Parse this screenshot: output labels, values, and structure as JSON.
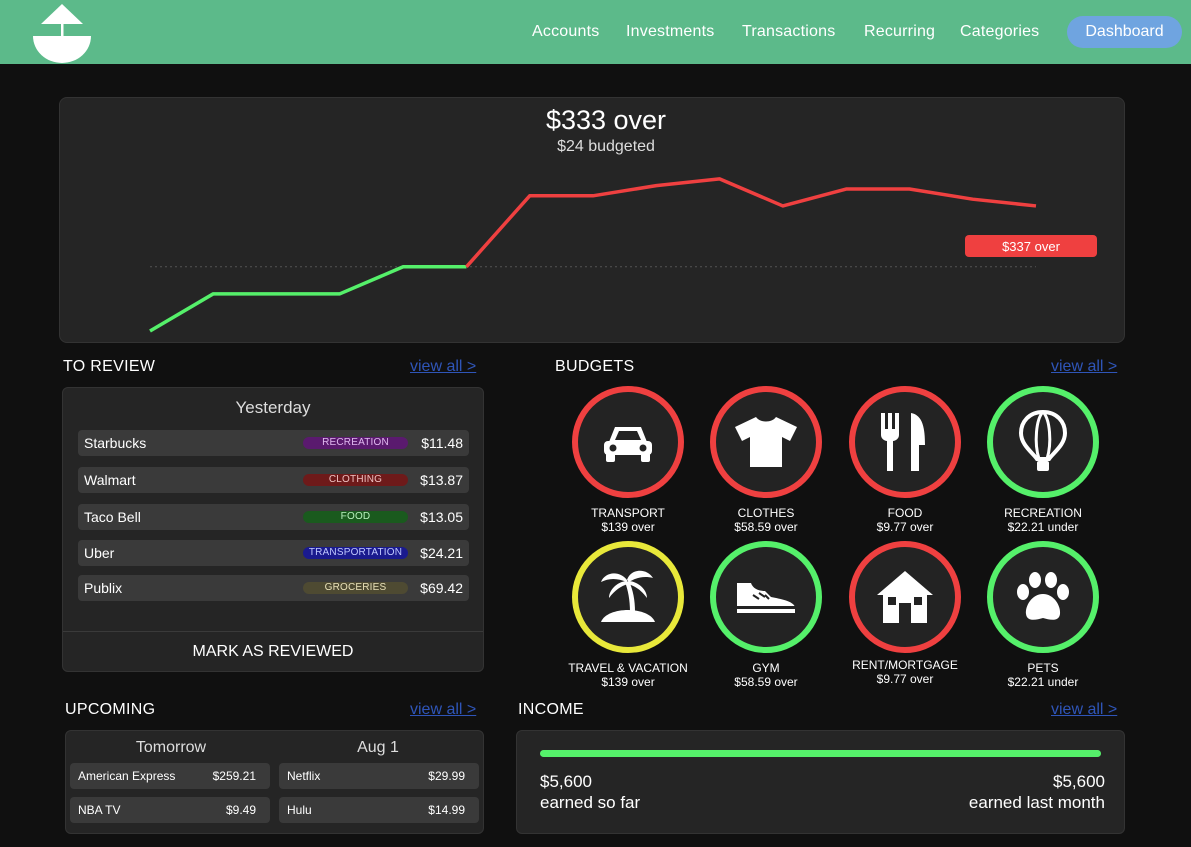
{
  "colors": {
    "header_bg": "#5cba8a",
    "over": "#ef4040",
    "under": "#55f06a",
    "warning": "#e8e83a",
    "active_nav": "#6fa4e0",
    "link": "#2f55b8"
  },
  "nav": {
    "items": [
      "Accounts",
      "Investments",
      "Transactions",
      "Recurring",
      "Categories"
    ],
    "active": "Dashboard"
  },
  "overview": {
    "headline": "$333 over",
    "subline": "$24 budgeted",
    "projection_label": "$337 over"
  },
  "chart_data": {
    "type": "line",
    "series": [
      {
        "values": [
          0,
          11,
          11,
          11,
          19,
          19,
          40,
          40,
          43,
          45,
          37,
          42,
          42,
          39,
          37
        ]
      }
    ],
    "budget_line": 19,
    "colors": {
      "under": "#55f06a",
      "over": "#ef4040"
    }
  },
  "to_review": {
    "title": "TO REVIEW",
    "view_all": "view all >",
    "day": "Yesterday",
    "rows": [
      {
        "merchant": "Starbucks",
        "category": "RECREATION",
        "amount": "$11.48",
        "tag_bg": "#5a1a6e",
        "tag_fg": "#e0b8f0"
      },
      {
        "merchant": "Walmart",
        "category": "CLOTHING",
        "amount": "$13.87",
        "tag_bg": "#6e1a1a",
        "tag_fg": "#f0c0c0"
      },
      {
        "merchant": "Taco Bell",
        "category": "FOOD",
        "amount": "$13.05",
        "tag_bg": "#1a5a1e",
        "tag_fg": "#b8f0bc"
      },
      {
        "merchant": "Uber",
        "category": "TRANSPORTATION",
        "amount": "$24.21",
        "tag_bg": "#1a1a8e",
        "tag_fg": "#c0c8ff"
      },
      {
        "merchant": "Publix",
        "category": "GROCERIES",
        "amount": "$69.42",
        "tag_bg": "#4e4a32",
        "tag_fg": "#e8e0b8"
      }
    ],
    "action": "MARK AS REVIEWED"
  },
  "budgets": {
    "title": "BUDGETS",
    "view_all": "view all >",
    "items": [
      {
        "name": "TRANSPORT",
        "status": "$139 over",
        "icon": "car-icon",
        "state": "over"
      },
      {
        "name": "CLOTHES",
        "status": "$58.59 over",
        "icon": "shirt-icon",
        "state": "over"
      },
      {
        "name": "FOOD",
        "status": "$9.77 over",
        "icon": "utensils-icon",
        "state": "over"
      },
      {
        "name": "RECREATION",
        "status": "$22.21 under",
        "icon": "hot-air-balloon-icon",
        "state": "under"
      },
      {
        "name": "TRAVEL & VACATION",
        "status": "$139 over",
        "icon": "palm-island-icon",
        "state": "warning"
      },
      {
        "name": "GYM",
        "status": "$58.59 over",
        "icon": "sneaker-icon",
        "state": "under"
      },
      {
        "name": "RENT/MORTGAGE",
        "status": "$9.77 over",
        "icon": "house-icon",
        "state": "over"
      },
      {
        "name": "PETS",
        "status": "$22.21 under",
        "icon": "paw-icon",
        "state": "under"
      }
    ]
  },
  "upcoming": {
    "title": "UPCOMING",
    "view_all": "view all >",
    "groups": [
      {
        "label": "Tomorrow",
        "items": [
          {
            "name": "American Express",
            "amount": "$259.21"
          },
          {
            "name": "NBA TV",
            "amount": "$9.49"
          }
        ]
      },
      {
        "label": "Aug 1",
        "items": [
          {
            "name": "Netflix",
            "amount": "$29.99"
          },
          {
            "name": "Hulu",
            "amount": "$14.99"
          }
        ]
      }
    ]
  },
  "income": {
    "title": "INCOME",
    "view_all": "view all >",
    "progress": 1.0,
    "earned_amount": "$5,600",
    "earned_label": "earned so far",
    "last_amount": "$5,600",
    "last_label": "earned last month"
  }
}
